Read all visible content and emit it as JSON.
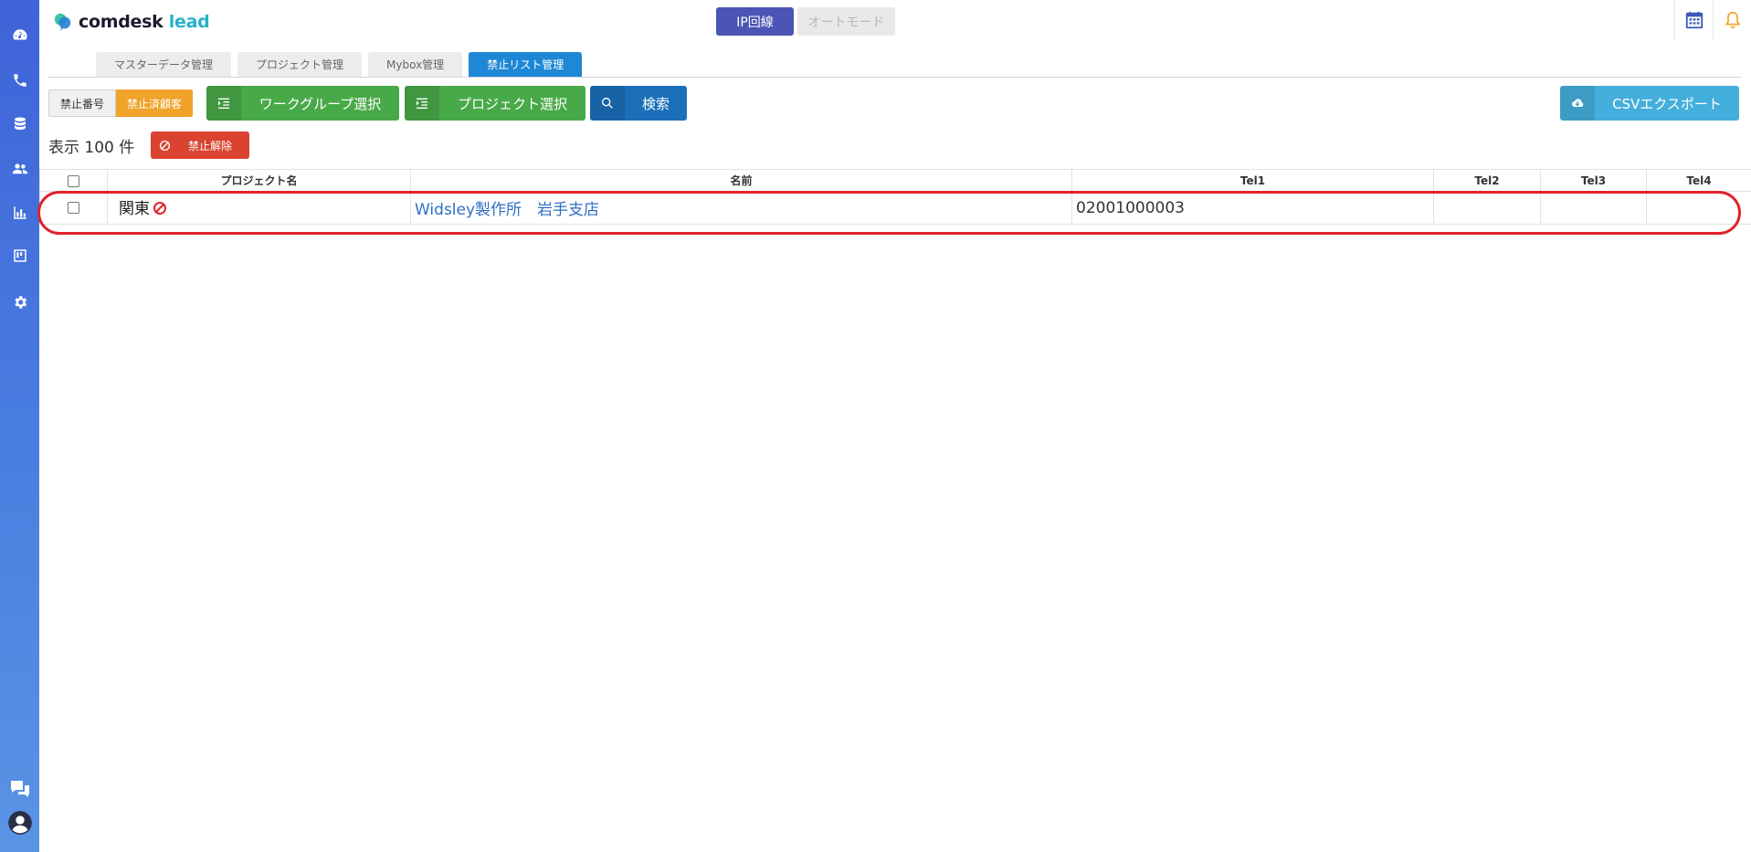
{
  "app": {
    "logo_main": "comdesk",
    "logo_accent": "lead"
  },
  "header": {
    "ip_label": "IP回線",
    "auto_label": "オートモード"
  },
  "tabs": [
    {
      "label": "マスターデータ管理",
      "active": false
    },
    {
      "label": "プロジェクト管理",
      "active": false
    },
    {
      "label": "Mybox管理",
      "active": false
    },
    {
      "label": "禁止リスト管理",
      "active": true
    }
  ],
  "toolbar": {
    "toggle_banned_numbers": "禁止番号",
    "toggle_banned_customers": "禁止済顧客",
    "workgroup_select": "ワークグループ選択",
    "project_select": "プロジェクト選択",
    "search": "検索",
    "csv_export": "CSVエクスポート"
  },
  "list": {
    "count_label": "表示 100 件",
    "unban_label": "禁止解除"
  },
  "table": {
    "columns": [
      "プロジェクト名",
      "名前",
      "Tel1",
      "Tel2",
      "Tel3",
      "Tel4"
    ],
    "rows": [
      {
        "project": "関東",
        "name": "Widsley製作所　岩手支店",
        "tel1": "02001000003",
        "tel2": "",
        "tel3": "",
        "tel4": ""
      }
    ]
  },
  "colors": {
    "primary": "#4a55b5",
    "active_tab": "#1e88d6",
    "green": "#48a948",
    "search_blue": "#1b6fb8",
    "csv_blue": "#44aedd",
    "orange": "#f0a32a",
    "danger": "#d9432f",
    "highlight": "#e0222a"
  }
}
